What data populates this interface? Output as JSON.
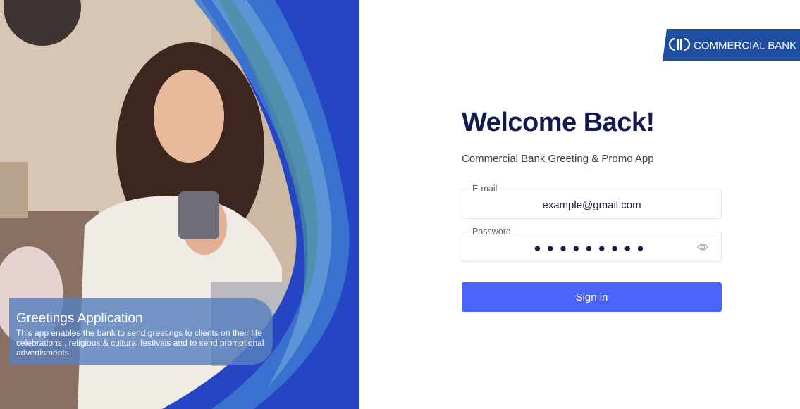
{
  "hero": {
    "caption_title": "Greetings Application",
    "caption_text": "This app enables the bank to send greetings to clients on their life celebrations , religious & cultural festivals and to send promotional advertisments.",
    "image_description_icon": "woman-using-phone-photo"
  },
  "brand": {
    "logo_text": "COMMERCIAL BANK",
    "logo_color": "#1f4ea1"
  },
  "login": {
    "title": "Welcome Back!",
    "subtitle": "Commercial Bank Greeting & Promo App",
    "email_label": "E-mail",
    "email_value": "example@gmail.com",
    "password_label": "Password",
    "password_mask": "●●●●●●●●●",
    "password_toggle_icon": "eye-icon",
    "sign_in_label": "Sign in"
  },
  "colors": {
    "primary_button": "#4b63f8",
    "title_color": "#131a4e",
    "hero_blue": "#2545c4"
  }
}
